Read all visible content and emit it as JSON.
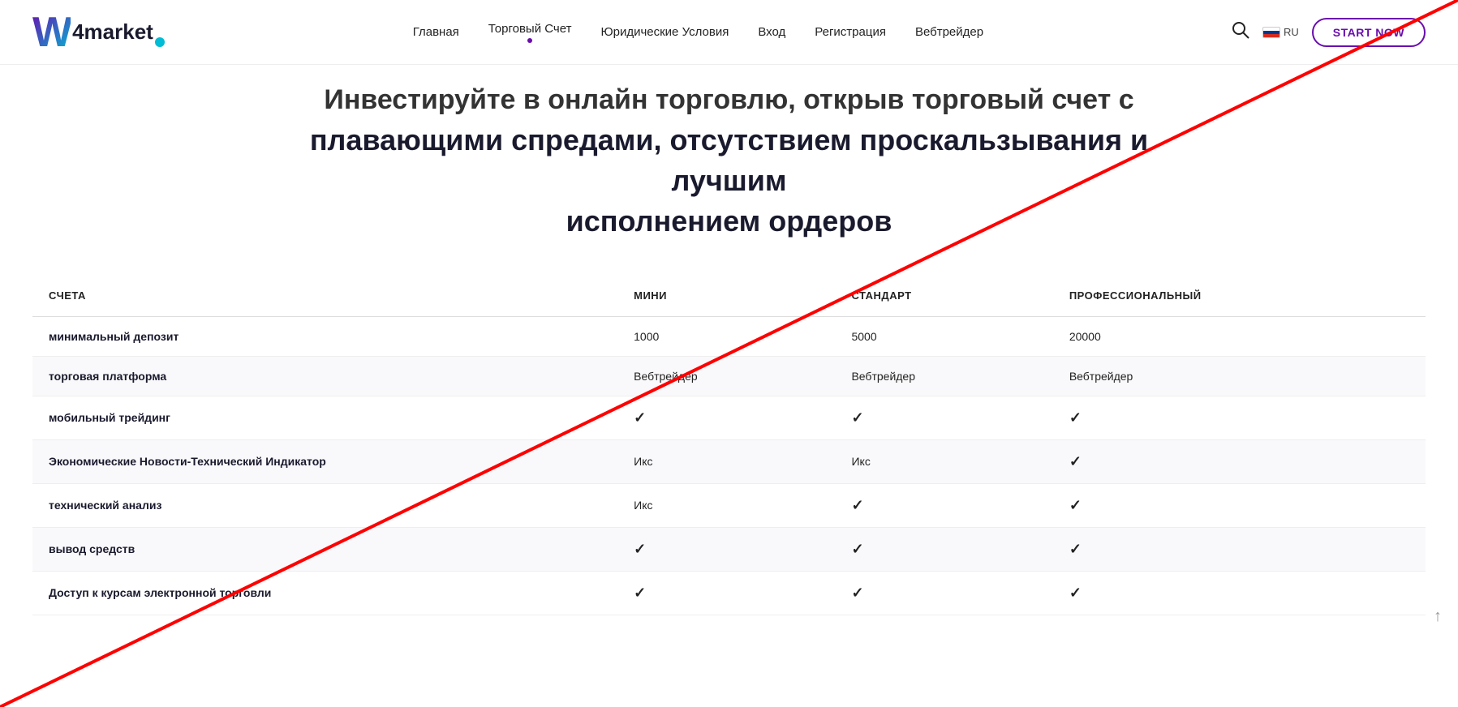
{
  "header": {
    "logo": {
      "w": "W",
      "text": "4market"
    },
    "nav": [
      {
        "label": "Главная",
        "active": false
      },
      {
        "label": "Торговый Счет",
        "active": true
      },
      {
        "label": "Юридические Условия",
        "active": false
      },
      {
        "label": "Вход",
        "active": false
      },
      {
        "label": "Регистрация",
        "active": false
      },
      {
        "label": "Вебтрейдер",
        "active": false
      }
    ],
    "lang": "RU",
    "start_now": "START NOW"
  },
  "hero": {
    "line1": "Инвестируйте в онлайн торговлю, открыв торговый счет с",
    "line2": "плавающими спредами, отсутствием проскальзывания и лучшим",
    "line3": "исполнением ордеров"
  },
  "table": {
    "headers": [
      "СЧЕТА",
      "МИНИ",
      "СТАНДАРТ",
      "ПРОФЕССИОНАЛЬНЫЙ"
    ],
    "rows": [
      {
        "label": "минимальный депозит",
        "mini": "1000",
        "standart": "5000",
        "prof": "20000",
        "type": "text"
      },
      {
        "label": "торговая платформа",
        "mini": "Вебтрейдер",
        "standart": "Вебтрейдер",
        "prof": "Вебтрейдер",
        "type": "text"
      },
      {
        "label": "мобильный трейдинг",
        "mini": "✓",
        "standart": "✓",
        "prof": "✓",
        "type": "check"
      },
      {
        "label": "Экономические Новости-Технический Индикатор",
        "mini": "Икс",
        "standart": "Икс",
        "prof": "✓",
        "type": "mixed"
      },
      {
        "label": "технический анализ",
        "mini": "Икс",
        "standart": "✓",
        "prof": "✓",
        "type": "mixed"
      },
      {
        "label": "вывод средств",
        "mini": "✓",
        "standart": "✓",
        "prof": "✓",
        "type": "check"
      },
      {
        "label": "Доступ к курсам электронной торговли",
        "mini": "✓",
        "standart": "✓",
        "prof": "✓",
        "type": "check"
      }
    ]
  }
}
